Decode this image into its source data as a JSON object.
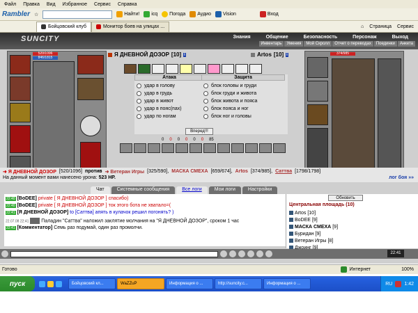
{
  "menu": [
    "Файл",
    "Правка",
    "Вид",
    "Избранное",
    "Сервис",
    "Справка"
  ],
  "toolbar": {
    "brand": "Rambler",
    "find_label": "Найти!",
    "icq_label": "icq",
    "weather_label": "Погода",
    "audio_label": "Аудио",
    "vision_label": "Vision",
    "login_label": "Вход",
    "page_label": "Страница",
    "service_label": "Сервис"
  },
  "tabs": [
    {
      "label": "Бойцовский клуб",
      "active": true
    },
    {
      "label": "Монитор боев на улицах ...",
      "active": false
    }
  ],
  "game": {
    "logo": "SUNCITY",
    "nav_top": [
      "Знания",
      "Общение",
      "Безопасность",
      "Персонаж",
      "Выход"
    ],
    "nav_bottom": [
      "Инвентарь",
      "Умения",
      "Мой Скролл",
      "Отчет о переводах",
      "Поединки",
      "Анкета"
    ],
    "player": {
      "name": "Я ДНЕВНОЙ ДОЗОР",
      "level": "[10]",
      "hp": "520/1096",
      "mana": "846/1815"
    },
    "enemy": {
      "name": "Artos",
      "level": "[10]",
      "hp": "374/985"
    },
    "attack": {
      "title": "Атака",
      "options": [
        "удар в голову",
        "удар в грудь",
        "удар в живот",
        "удар в пояс(пах)",
        "удар по ногам"
      ]
    },
    "defense": {
      "title": "Защита",
      "options": [
        "блок головы и груди",
        "блок груди и живота",
        "блок живота и пояса",
        "блок пояса и ног",
        "блок ног и головы"
      ]
    },
    "forward_label": "Вперед!!!",
    "counters": [
      "0",
      "0",
      "0",
      "0",
      "0",
      "0",
      "85"
    ],
    "fighters_line": {
      "player": "Я ДНЕВНОЙ ДОЗОР",
      "player_hp": "[520/1096]",
      "versus": "против",
      "opp1": "Ветеран Игры",
      "opp1_hp": "[325/590],",
      "opp2": "МАСКА СМЕХА",
      "opp2_hp": "[659/674],",
      "opp3": "Artos",
      "opp3_hp": "[374/985],",
      "opp4": "Саттва",
      "opp4_hp": "[1798/1798]",
      "log_label": "лог боя »»"
    },
    "damage_text": "На данный момент вами нанесено урона:",
    "damage_value": "523 HP."
  },
  "chat_tabs": [
    "Чат",
    "Системные сообщения",
    "Все логи",
    "Мои логи",
    "Настройки"
  ],
  "chat": [
    {
      "time": "22:40",
      "nick": "[BoDEE]",
      "kind": "private",
      "target": "[ Я ДНЕВНОЙ ДОЗОР ]",
      "text": "спасибо)"
    },
    {
      "time": "22:40",
      "nick": "[BoDEE]",
      "kind": "private",
      "target": "[ Я ДНЕВНОЙ ДОЗОР ]",
      "text": "ток этого бота не хватало=("
    },
    {
      "time": "22:41",
      "nick": "[Я ДНЕВНОЙ ДОЗОР]",
      "kind": "to",
      "target": "[Саттва]",
      "text": "апять в кулачок решил погонять? )"
    },
    {
      "time": "22.07.08 22:41",
      "nick": "",
      "kind": "sys",
      "target": "",
      "text": "Паладин \"Саттва\" наложил заклятие молчания на \"Я ДНЕВНОЙ ДОЗОР\", сроком 1 час"
    },
    {
      "time": "22:41",
      "nick": "[Комментатор]",
      "kind": "comment",
      "target": "",
      "text": "Семь раз подумай, один раз промолчи."
    }
  ],
  "users": {
    "refresh_label": "Обновить",
    "room": "Центральная площадь (10)",
    "list": [
      {
        "name": "Artos",
        "level": "[10]"
      },
      {
        "name": "BoDEE",
        "level": "[9]"
      },
      {
        "name": "МАСКА СМЕХА",
        "level": "[9]"
      },
      {
        "name": "Буридан",
        "level": "[9]"
      },
      {
        "name": "Ветеран Игры",
        "level": "[8]"
      },
      {
        "name": "Джоинг",
        "level": "[9]"
      }
    ]
  },
  "game_clock": "22:41",
  "statusbar": {
    "left": "Готово",
    "zone": "Интернет",
    "zoom": "100%"
  },
  "taskbar": {
    "start": "пуск",
    "tasks": [
      {
        "label": "Бойцовский кл...",
        "active": false
      },
      {
        "label": "WaZZuP",
        "active": true
      },
      {
        "label": "Информация о ...",
        "active": false
      },
      {
        "label": "http://suncity.c...",
        "active": false
      },
      {
        "label": "Информация о ...",
        "active": false
      }
    ],
    "lang": "RU",
    "time": "1:42"
  }
}
